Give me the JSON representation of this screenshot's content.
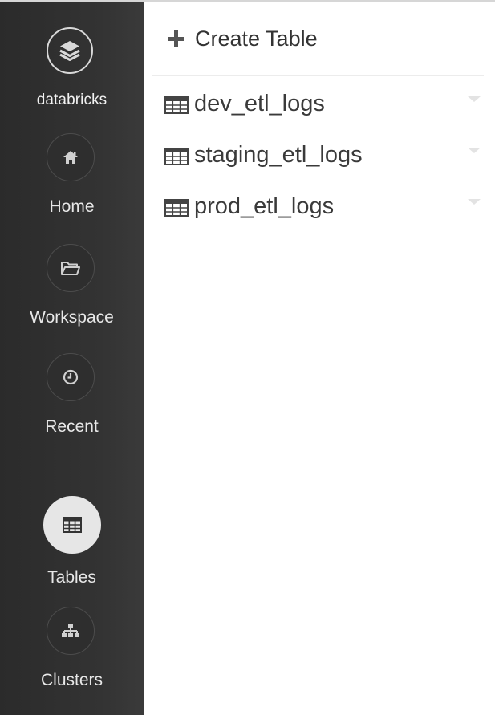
{
  "brand": {
    "name": "databricks",
    "logo_icon": "layers-icon"
  },
  "sidebar": {
    "items": [
      {
        "label": "Home",
        "icon": "home-icon",
        "active": false
      },
      {
        "label": "Workspace",
        "icon": "folder-open-icon",
        "active": false
      },
      {
        "label": "Recent",
        "icon": "clock-icon",
        "active": false
      },
      {
        "label": "Tables",
        "icon": "table-icon",
        "active": true
      },
      {
        "label": "Clusters",
        "icon": "cluster-icon",
        "active": false
      }
    ]
  },
  "main": {
    "create_button": {
      "label": "Create Table",
      "icon": "plus-icon"
    },
    "tables": [
      {
        "name": "dev_etl_logs",
        "icon": "table-icon"
      },
      {
        "name": "staging_etl_logs",
        "icon": "table-icon"
      },
      {
        "name": "prod_etl_logs",
        "icon": "table-icon"
      }
    ]
  },
  "colors": {
    "sidebar_bg": "#2b2b2b",
    "sidebar_text": "#e8e8e8",
    "active_circle": "#e6e6e6",
    "main_bg": "#ffffff",
    "text": "#3a3a3a"
  }
}
